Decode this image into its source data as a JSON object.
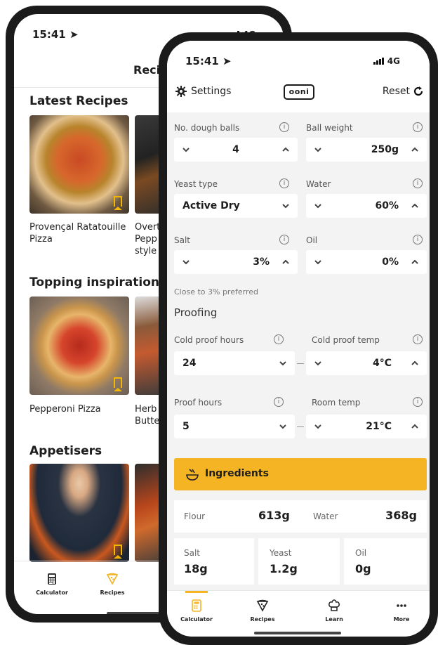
{
  "back_phone": {
    "status": {
      "time": "15:41",
      "network": "4G"
    },
    "header_title": "Recip",
    "sections": [
      {
        "title": "Latest Recipes",
        "items": [
          "Provençal Ratatouille Pizza",
          "Overt Pepp style"
        ]
      },
      {
        "title": "Topping inspiration",
        "items": [
          "Pepperoni Pizza",
          "Herb Butte"
        ]
      },
      {
        "title": "Appetisers",
        "items": []
      }
    ],
    "tabbar": [
      {
        "label": "Calculator",
        "icon": "calculator-icon"
      },
      {
        "label": "Recipes",
        "icon": "pizza-slice-icon"
      }
    ]
  },
  "front_phone": {
    "status": {
      "time": "15:41",
      "network": "4G"
    },
    "topbar": {
      "settings_label": "Settings",
      "logo_text": "ooni",
      "reset_label": "Reset"
    },
    "dough_balls": {
      "label": "No. dough balls",
      "value": "4"
    },
    "ball_weight": {
      "label": "Ball weight",
      "value": "250g"
    },
    "yeast_type": {
      "label": "Yeast type",
      "value": "Active Dry"
    },
    "water": {
      "label": "Water",
      "value": "60%"
    },
    "salt": {
      "label": "Salt",
      "value": "3%"
    },
    "oil": {
      "label": "Oil",
      "value": "0%"
    },
    "salt_hint": "Close to 3% preferred",
    "proofing_title": "Proofing",
    "cold_proof_hours": {
      "label": "Cold proof hours",
      "value": "24"
    },
    "cold_proof_temp": {
      "label": "Cold proof temp",
      "value": "4°C"
    },
    "proof_hours": {
      "label": "Proof hours",
      "value": "5"
    },
    "room_temp": {
      "label": "Room temp",
      "value": "21°C"
    },
    "ingredients": {
      "title": "Ingredients",
      "flour_label": "Flour",
      "flour_value": "613g",
      "water_label": "Water",
      "water_value": "368g",
      "salt_label": "Salt",
      "salt_value": "18g",
      "yeast_label": "Yeast",
      "yeast_value": "1.2g",
      "oil_label": "Oil",
      "oil_value": "0g"
    },
    "tabbar": [
      {
        "label": "Calculator",
        "icon": "calculator-icon",
        "active": true
      },
      {
        "label": "Recipes",
        "icon": "pizza-slice-icon"
      },
      {
        "label": "Learn",
        "icon": "chef-hat-icon"
      },
      {
        "label": "More",
        "icon": "more-dots-icon"
      }
    ]
  },
  "colors": {
    "accent": "#f4b423",
    "frame": "#1b1b1b",
    "bookmark": "#f2b705"
  }
}
